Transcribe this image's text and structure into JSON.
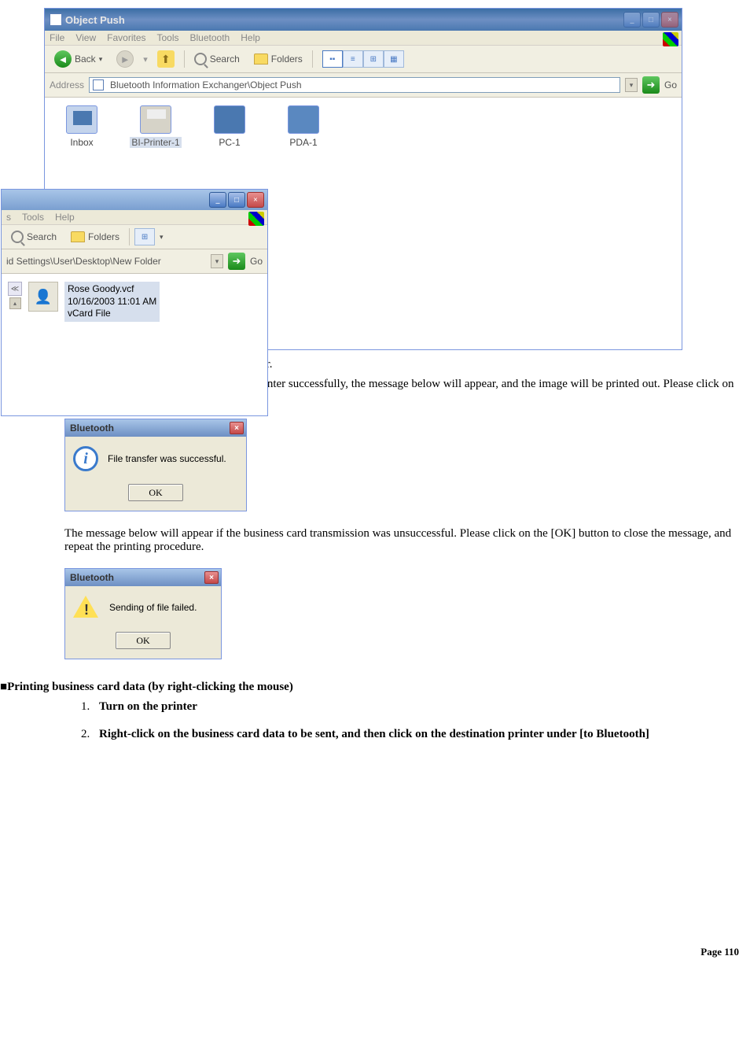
{
  "main_window": {
    "title": "Object Push",
    "menus": [
      "File",
      "View",
      "Favorites",
      "Tools",
      "Bluetooth",
      "Help"
    ],
    "toolbar": {
      "back": "Back",
      "search": "Search",
      "folders": "Folders"
    },
    "address_label": "Address",
    "address_value": "Bluetooth Information Exchanger\\Object Push",
    "go": "Go",
    "items": [
      {
        "label": "Inbox",
        "type": "inbox"
      },
      {
        "label": "BI-Printer-1",
        "type": "printer",
        "selected": true
      },
      {
        "label": "PC-1",
        "type": "pc"
      },
      {
        "label": "PDA-1",
        "type": "pda"
      }
    ]
  },
  "overlay_window": {
    "menus_partial": [
      "s",
      "Tools",
      "Help"
    ],
    "toolbar": {
      "search": "Search",
      "folders": "Folders"
    },
    "address_value": "id Settings\\User\\Desktop\\New Folder",
    "go": "Go",
    "file": {
      "name": "Rose Goody.vcf",
      "date": "10/16/2003 11:01 AM",
      "type": "vCard File"
    }
  },
  "para1": "The business card will be sent to the printer.",
  "para2": "If the business card has been sent to the printer successfully, the message below will appear, and the image will be printed out. Please click on the [OK] button.",
  "dialog_success": {
    "title": "Bluetooth",
    "msg": "File transfer was successful.",
    "ok": "OK"
  },
  "para3": "The message below will appear if the business card transmission was unsuccessful. Please click on the [OK] button to close the message, and repeat the printing procedure.",
  "dialog_fail": {
    "title": "Bluetooth",
    "msg": "Sending of file failed.",
    "ok": "OK"
  },
  "section_heading": "Printing business card data (by right-clicking the mouse)",
  "steps": [
    "Turn on the printer",
    "Right-click on the business card data to be sent, and then click on the destination printer under [to Bluetooth]"
  ],
  "page_footer": "Page 110"
}
